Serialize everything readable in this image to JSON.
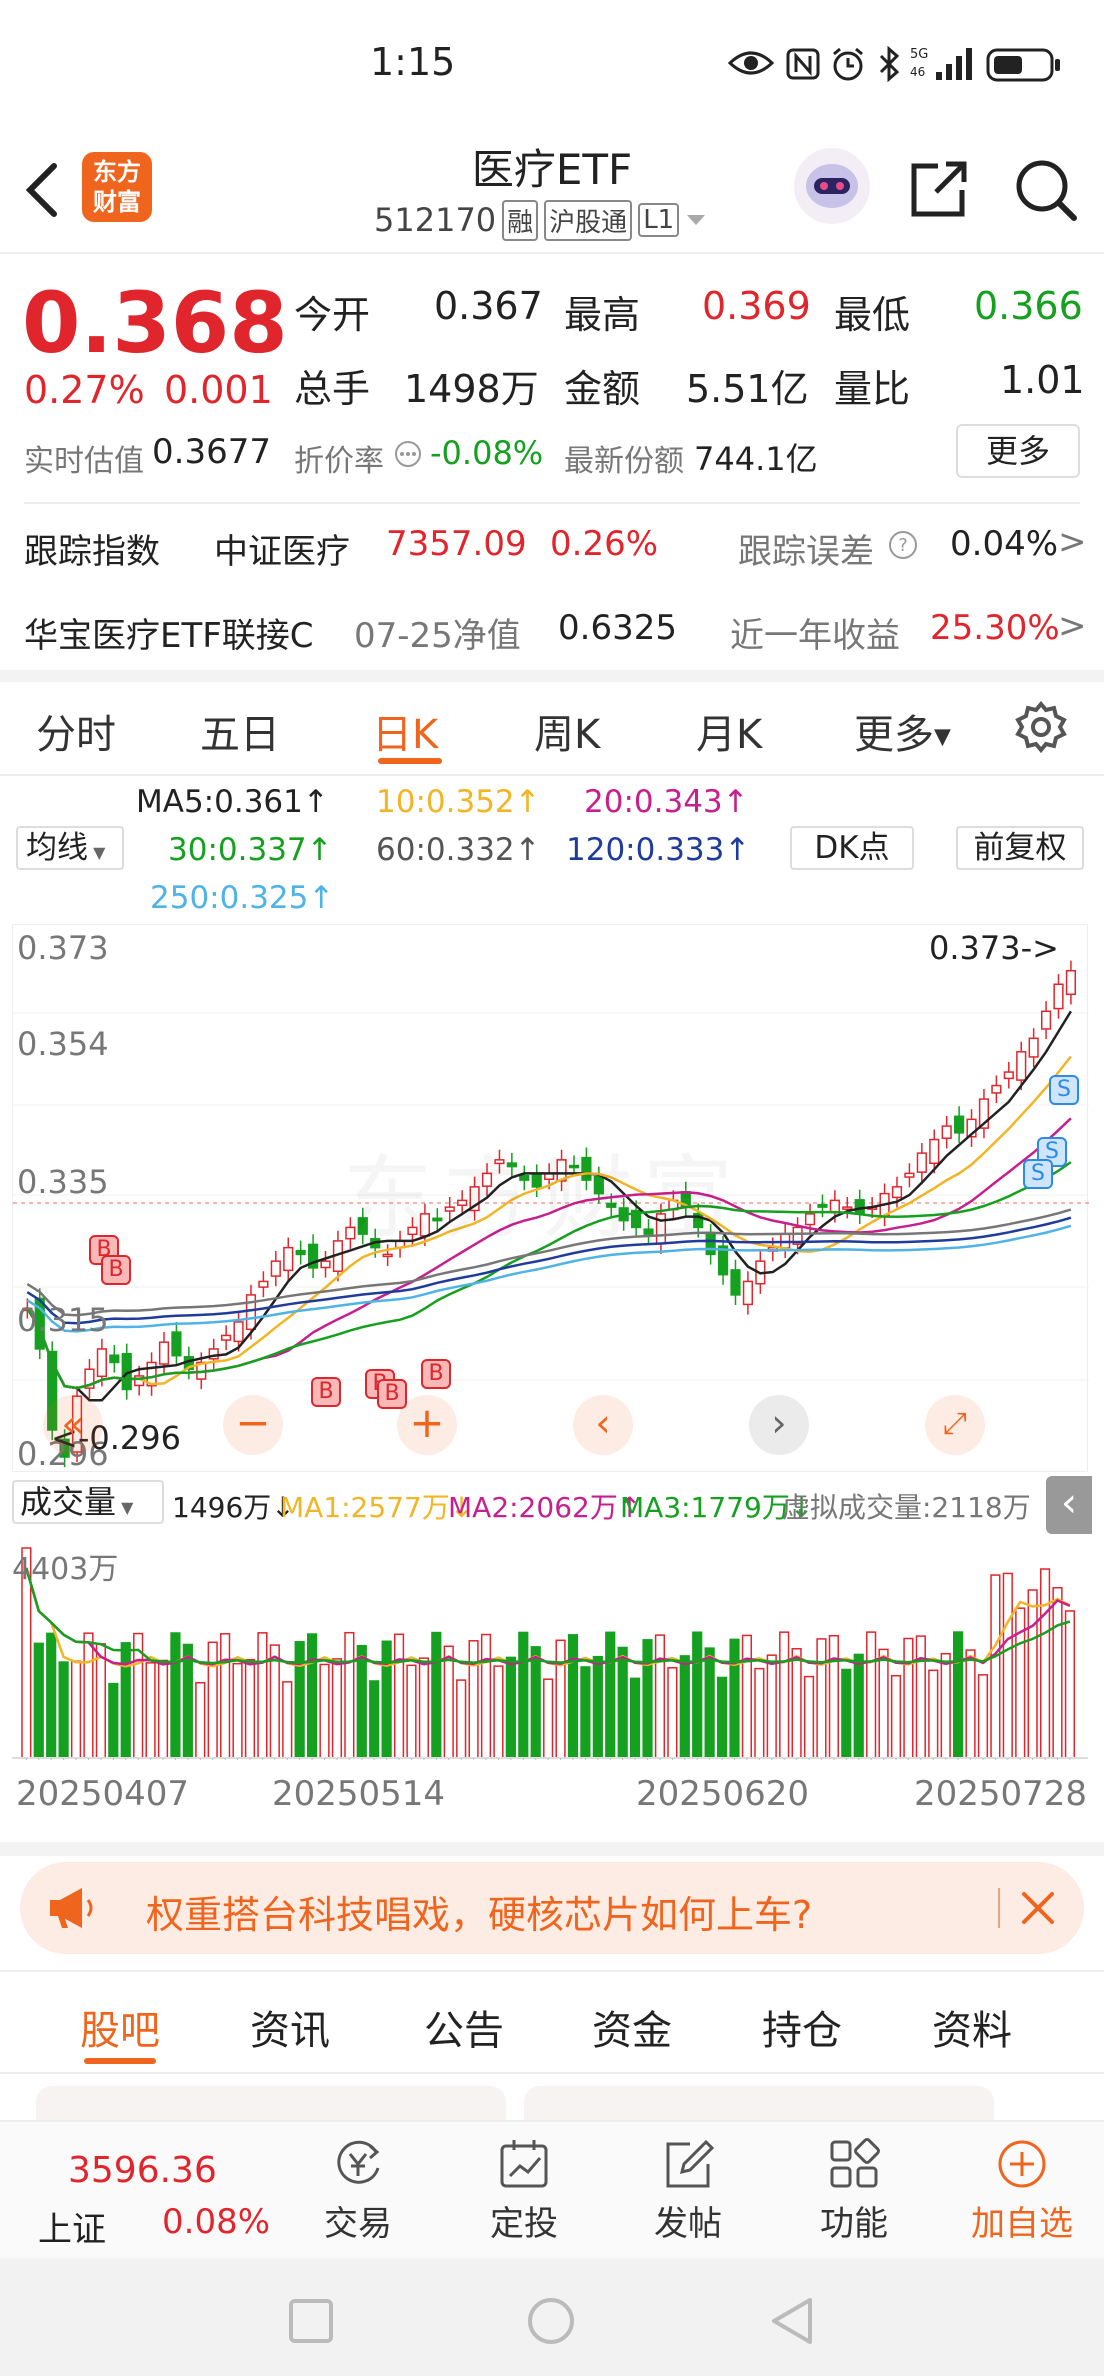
{
  "status_bar": {
    "time": "1:15",
    "icons": [
      "eye-icon",
      "nfc-icon",
      "alarm-icon",
      "bluetooth-icon",
      "5g-signal-icon",
      "battery-icon"
    ]
  },
  "header": {
    "logo_line1": "东方",
    "logo_line2": "财富",
    "title": "医疗ETF",
    "code": "512170",
    "badge1": "融",
    "badge2": "沪股通",
    "badge3": "L1"
  },
  "quote": {
    "price": "0.368",
    "change_pct": "0.27%",
    "change_abs": "0.001",
    "open_label": "今开",
    "open": "0.367",
    "high_label": "最高",
    "high": "0.369",
    "low_label": "最低",
    "low": "0.366",
    "volume_label": "总手",
    "volume": "1498万",
    "amount_label": "金额",
    "amount": "5.51亿",
    "ratio_label": "量比",
    "ratio": "1.01",
    "iopv_label": "实时估值",
    "iopv": "0.3677",
    "discount_label": "折价率",
    "discount": "-0.08%",
    "share_label": "最新份额",
    "share": "744.1亿",
    "more_button": "更多"
  },
  "tracking": {
    "label": "跟踪指数",
    "index_name": "中证医疗",
    "index_value": "7357.09",
    "index_pct": "0.26%",
    "error_label": "跟踪误差",
    "error_value": "0.04%"
  },
  "linked": {
    "name": "华宝医疗ETF联接C",
    "nav_label": "07-25净值",
    "nav": "0.6325",
    "ret_label": "近一年收益",
    "ret": "25.30%"
  },
  "period_tabs": [
    "分时",
    "五日",
    "日K",
    "周K",
    "月K",
    "更多"
  ],
  "active_tab": 2,
  "ma_legend": {
    "selector": "均线",
    "ma5": "MA5:0.361↑",
    "ma10": "10:0.352↑",
    "ma20": "20:0.343↑",
    "ma30": "30:0.337↑",
    "ma60": "60:0.332↑",
    "ma120": "120:0.333↑",
    "ma250": "250:0.325↑",
    "dk_button": "DK点",
    "adjust_button": "前复权"
  },
  "kline": {
    "y_labels": [
      "0.373",
      "0.354",
      "0.335",
      "0.315",
      "0.296"
    ],
    "high_marker": "0.373->",
    "low_marker": "<-0.296",
    "watermark": "东方财富"
  },
  "volume_panel": {
    "selector": "成交量",
    "vol": "1496万↓",
    "ma1": "MA1:2577万↓",
    "ma2": "MA2:2062万↑",
    "ma3": "MA3:1779万↓",
    "virtual": "虚拟成交量:2118万",
    "top_label": "4403万",
    "dates": [
      "20250407",
      "20250514",
      "20250620",
      "20250728"
    ]
  },
  "banner": {
    "text": "权重搭台科技唱戏，硬核芯片如何上车?"
  },
  "content_tabs": [
    "股吧",
    "资讯",
    "公告",
    "资金",
    "持仓",
    "资料"
  ],
  "active_content_tab": 0,
  "bottom_bar": {
    "index_value": "3596.36",
    "index_name": "上证",
    "index_pct": "0.08%",
    "items": [
      "交易",
      "定投",
      "发帖",
      "功能",
      "加自选"
    ]
  },
  "colors": {
    "up": "#e0262c",
    "down": "#15a020",
    "accent": "#f0651e"
  }
}
